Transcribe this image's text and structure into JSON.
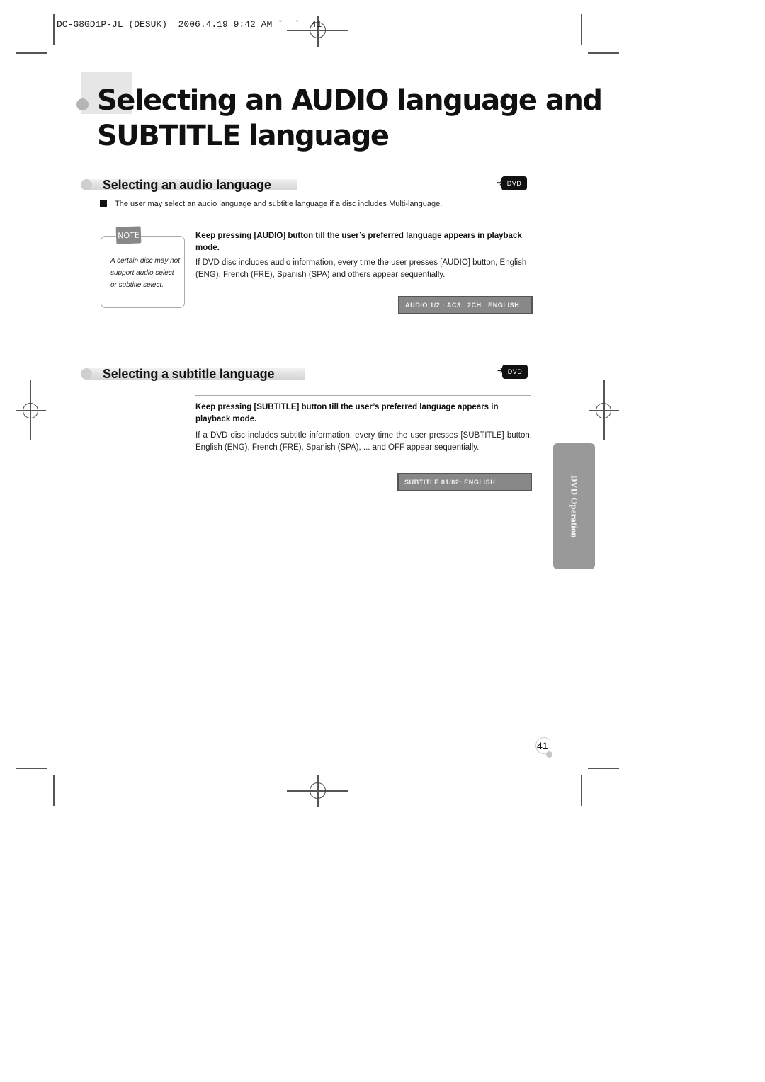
{
  "slug_line": "DC-G8GD1P-JL (DESUK)  2006.4.19 9:42 AM ˘  `  41",
  "page_title": {
    "line1": "Selecting an AUDIO language and",
    "line2": "SUBTITLE language"
  },
  "audio_section": {
    "heading": "Selecting an audio language",
    "badge": "DVD",
    "intro": "The user may select an audio language and subtitle language if a disc includes Multi-language.",
    "note": {
      "tab_label": "NOTE",
      "text": "A certain disc may not support audio select or subtitle select."
    },
    "instruction_bold": "Keep pressing [AUDIO] button till the user’s preferred language appears in playback mode.",
    "instruction_body": "If DVD disc includes audio information, every time the user presses [AUDIO] button, English (ENG), French (FRE), Spanish (SPA) and others appear sequentially.",
    "osd_display": "AUDIO 1/2 : AC3   2CH   ENGLISH"
  },
  "subtitle_section": {
    "heading": "Selecting a subtitle language",
    "badge": "DVD",
    "instruction_bold": "Keep pressing [SUBTITLE] button till the user’s preferred language appears in playback mode.",
    "instruction_body": "If a DVD disc includes subtitle information, every time the user presses [SUBTITLE] button, English (ENG), French (FRE), Spanish (SPA), ...  and OFF appear sequentially.",
    "osd_display": "SUBTITLE 01/02: ENGLISH"
  },
  "side_tab": "DVD Operation",
  "page_number": "41"
}
